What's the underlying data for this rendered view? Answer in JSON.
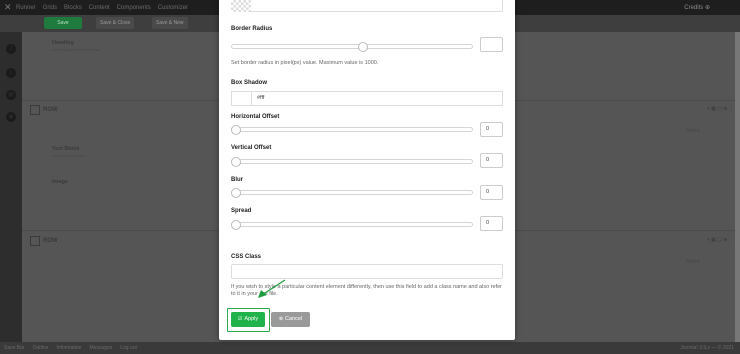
{
  "app": {
    "nav": [
      "Runner",
      "Grids",
      "Blocks",
      "Content",
      "Components",
      "Customizer"
    ],
    "credits": "Credits ⊕",
    "toolbar": {
      "save": "Save",
      "save_close": "Save & Close",
      "save_new": "Save & New"
    },
    "canvas": {
      "heading_block": {
        "title": "Heading",
        "subtitle": "Lorem ipsum dolor sit amet"
      },
      "row1": "ROW",
      "text_block": {
        "title": "Text Block",
        "subtitle": "Lorem ipsum dolor"
      },
      "image_block": "Image",
      "row2": "ROW",
      "addon_label": "Addon"
    },
    "status": [
      "Save Bar",
      "Outline",
      "Information",
      "Messages",
      "Log out"
    ],
    "status_right": "Joomla! 3.9.x — © 2021"
  },
  "modal": {
    "border_radius": {
      "label": "Border Radius",
      "value": "",
      "help": "Set border radius in pixel(px) value. Maximum value is 1000."
    },
    "box_shadow": {
      "label": "Box Shadow",
      "value": "#fff"
    },
    "horizontal_offset": {
      "label": "Horizontal Offset",
      "value": "0"
    },
    "vertical_offset": {
      "label": "Vertical Offset",
      "value": "0"
    },
    "blur": {
      "label": "Blur",
      "value": "0"
    },
    "spread": {
      "label": "Spread",
      "value": "0"
    },
    "css_class": {
      "label": "CSS Class",
      "value": "",
      "help": "If you wish to style a particular content element differently, then use this field to add a class name and also refer to it in your css file."
    },
    "apply_label": "Apply",
    "cancel_label": "Cancel"
  },
  "colors": {
    "accent_green": "#20b24b",
    "cancel_gray": "#9a9a9a",
    "overlay": "#5c5c5c"
  }
}
